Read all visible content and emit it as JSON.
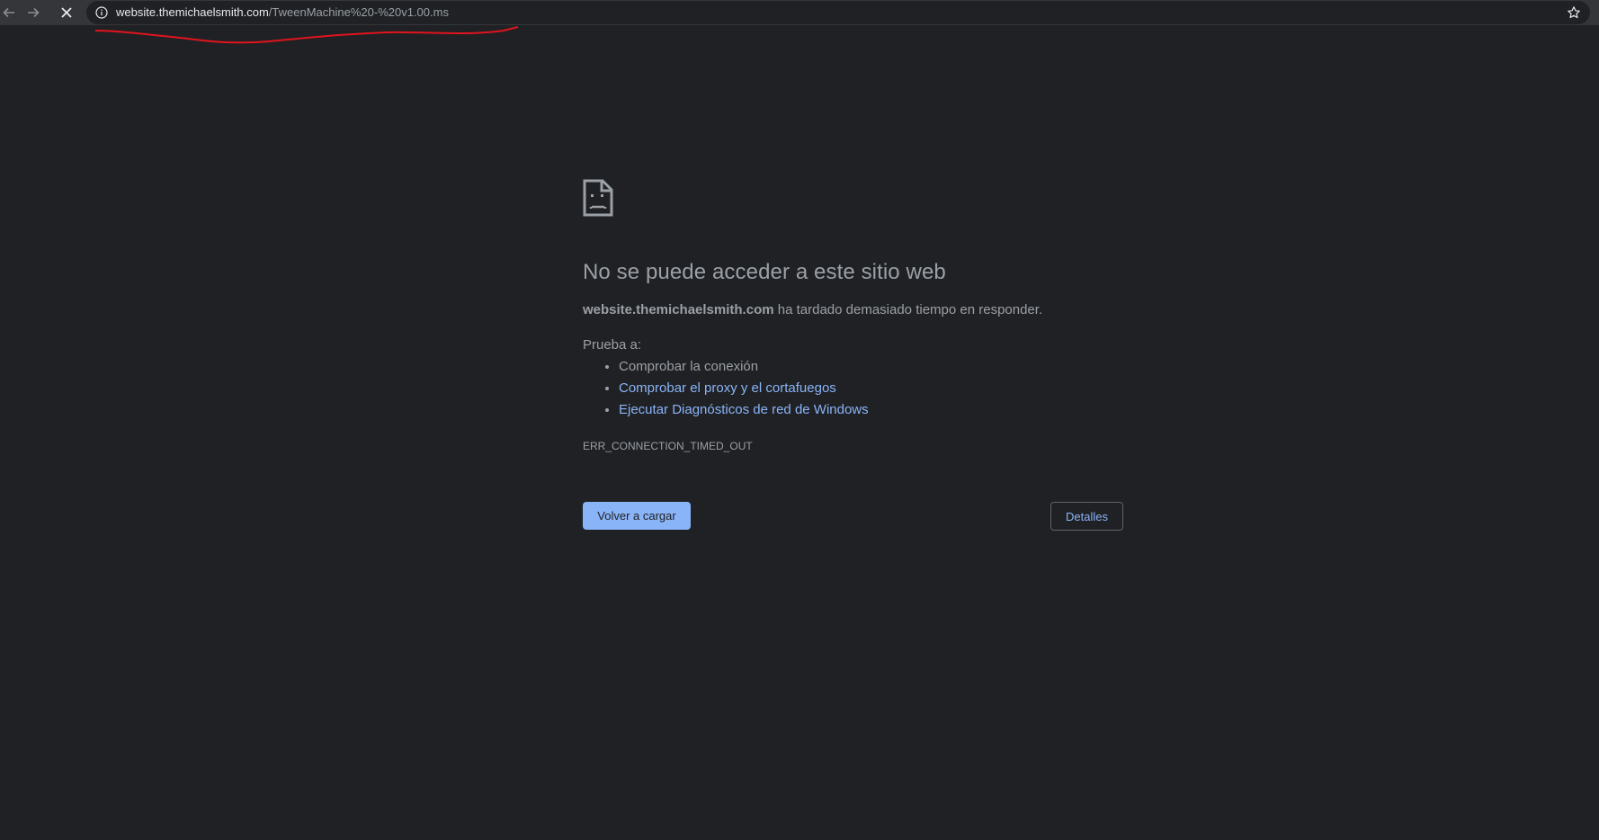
{
  "browser": {
    "url_host": "website.themichaelsmith.com",
    "url_path": "/TweenMachine%20-%20v1.00.ms",
    "icons": {
      "back": "back-arrow-icon",
      "forward": "forward-arrow-icon",
      "stop": "close-icon",
      "info": "info-icon",
      "bookmark": "star-icon"
    },
    "annotation_color": "#e0141e"
  },
  "error": {
    "icon": "sad-file-icon",
    "heading": "No se puede acceder a este sitio web",
    "host": "website.themichaelsmith.com",
    "message": " ha tardado demasiado tiempo en responder.",
    "try_label": "Prueba a:",
    "suggestions": [
      "Comprobar la conexión",
      "Comprobar el proxy y el cortafuegos",
      "Ejecutar Diagnósticos de red de Windows"
    ],
    "code": "ERR_CONNECTION_TIMED_OUT",
    "reload_label": "Volver a cargar",
    "details_label": "Detalles"
  },
  "colors": {
    "background": "#202124",
    "text": "#9aa0a6",
    "link": "#8ab4f8",
    "primary_button": "#8ab4f8"
  }
}
